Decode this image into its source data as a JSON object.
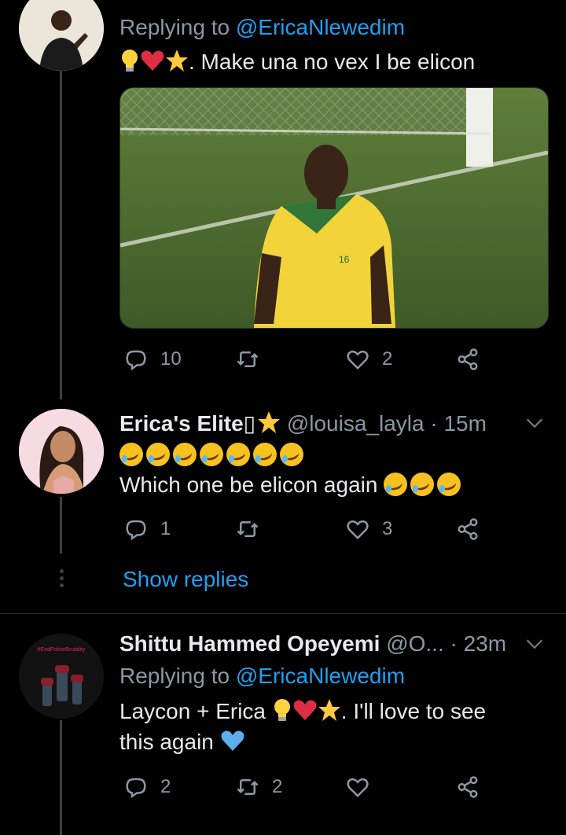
{
  "tweets": [
    {
      "replying_to_prefix": "Replying to ",
      "replying_to_handle": "@EricaNlewedim",
      "text_after_emojis": ". Make una no vex I be elicon",
      "media_jersey_number": "16",
      "stats": {
        "replies": "10",
        "retweets": "",
        "likes": "2"
      }
    },
    {
      "name": "Erica's Elite▯",
      "handle": "@louisa_layla",
      "time": "· 15m",
      "text": "Which one be elicon again",
      "stats": {
        "replies": "1",
        "retweets": "",
        "likes": "3"
      },
      "show_replies": "Show replies"
    },
    {
      "name": "Shittu Hammed Opeyemi",
      "handle": "@O...",
      "time": "· 23m",
      "replying_to_prefix": "Replying to ",
      "replying_to_handle": "@EricaNlewedim",
      "text_line1_prefix": "Laycon + Erica ",
      "text_line1_suffix": ". I'll love to see",
      "text_line2": "this again",
      "avatar_badge": "#EndPoliceBrutality",
      "stats": {
        "replies": "2",
        "retweets": "2",
        "likes": ""
      }
    }
  ],
  "colors": {
    "background": "#000000",
    "accent": "#1da1f2",
    "muted": "#8b98a5",
    "heart": "#e0245e",
    "star": "#ffc83d"
  }
}
